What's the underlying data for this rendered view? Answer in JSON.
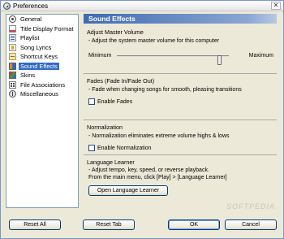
{
  "window": {
    "title": "Preferences",
    "close_glyph": "✕"
  },
  "nav": {
    "items": [
      {
        "label": "General",
        "icon": "general-icon"
      },
      {
        "label": "Title Display Format",
        "icon": "title-display-icon"
      },
      {
        "label": "Playlist",
        "icon": "playlist-icon"
      },
      {
        "label": "Song Lyrics",
        "icon": "lyrics-icon"
      },
      {
        "label": "Shortcut Keys",
        "icon": "keyboard-icon"
      },
      {
        "label": "Sound Effects",
        "icon": "sound-effects-icon",
        "selected": true
      },
      {
        "label": "Skins",
        "icon": "skins-icon"
      },
      {
        "label": "File Associations",
        "icon": "file-associations-icon"
      },
      {
        "label": "Miscellaneous",
        "icon": "miscellaneous-icon"
      }
    ]
  },
  "panel": {
    "header": "Sound Effects",
    "master_volume": {
      "title": "Adjust Master Volume",
      "description": "- Adjust the system master volume for this computer",
      "min_label": "Minimum",
      "max_label": "Maximum",
      "level": 0.93
    },
    "fades": {
      "title": "Fades (Fade In/Fade Out)",
      "description": "- Fade when changing songs for smooth, pleasing transitions",
      "checkbox_label": "Enable Fades",
      "checked": false
    },
    "normalization": {
      "title": "Normalization",
      "description": "- Normalization eliminates extreme volume highs & lows",
      "checkbox_label": "Enable Normalization",
      "checked": false
    },
    "language_learner": {
      "title": "Language Learner",
      "description_line1": "- Adjust tempo, key, speed, or reverse playback.",
      "description_line2": "From the main menu, click [Play] > [Language Learner]",
      "button_label": "Open Language Learner"
    }
  },
  "footer": {
    "reset_all": "Reset All",
    "reset_tab": "Reset Tab",
    "ok": "OK",
    "cancel": "Cancel"
  },
  "watermark": "SOFTPEDIA"
}
